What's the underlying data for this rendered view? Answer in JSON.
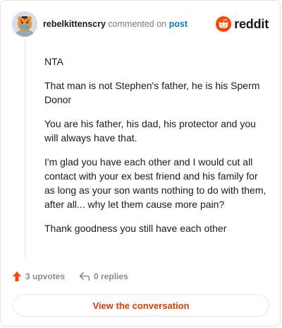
{
  "comment": {
    "author": "rebelkittenscry",
    "action_text": "commented on",
    "post_link": "post",
    "paragraphs": [
      "NTA",
      "That man is not Stephen's father, he is his Sperm Donor",
      "You are his father, his dad, his protector and you will always have that.",
      "I'm glad you have each other and I would cut all contact with your ex best friend and his family for as long as your son wants nothing to do with them, after all... why let them cause more pain?",
      "Thank goodness you still have each other"
    ]
  },
  "brand": {
    "name": "reddit",
    "color": "#ff4500"
  },
  "actions": {
    "upvotes": "3 upvotes",
    "replies": "0 replies"
  },
  "cta": {
    "label": "View the conversation"
  },
  "colors": {
    "link": "#0079d3",
    "cta_text": "#d93a00",
    "upvote": "#ff4500"
  }
}
